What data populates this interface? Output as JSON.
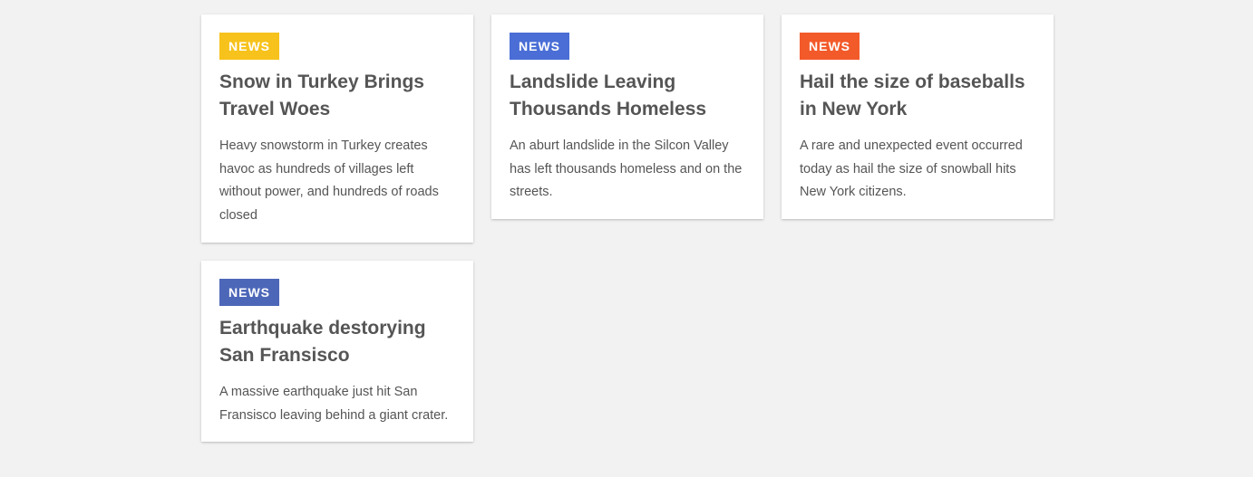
{
  "cards": [
    {
      "tag": "NEWS",
      "tag_color": "#f7c21b",
      "title": "Snow in Turkey Brings Travel Woes",
      "body": "Heavy snowstorm in Turkey creates havoc as hundreds of villages left without power, and hundreds of roads closed"
    },
    {
      "tag": "NEWS",
      "tag_color": "#4a6ed6",
      "title": "Landslide Leaving Thousands Homeless",
      "body": "An aburt landslide in the Silcon Valley has left thousands homeless and on the streets."
    },
    {
      "tag": "NEWS",
      "tag_color": "#f35a2a",
      "title": "Hail the size of baseballs in New York",
      "body": "A rare and unexpected event occurred today as hail the size of snowball hits New York citizens."
    },
    {
      "tag": "NEWS",
      "tag_color": "#4d67b8",
      "title": "Earthquake destorying San Fransisco",
      "body": "A massive earthquake just hit San Fransisco leaving behind a giant crater."
    }
  ]
}
